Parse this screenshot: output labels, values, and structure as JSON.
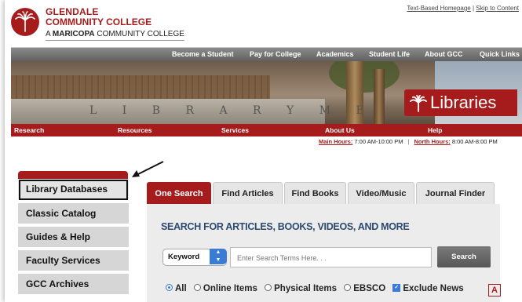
{
  "header": {
    "college_line1": "GLENDALE",
    "college_line2": "COMMUNITY COLLEGE",
    "maricopa_prefix": "A ",
    "maricopa_bold": "MARICOPA",
    "maricopa_suffix": " COMMUNITY COLLEGE",
    "link_text_based": "Text-Based Homepage",
    "link_sep": " | ",
    "link_skip": "Skip to Content"
  },
  "topnav": [
    "Become a Student",
    "Pay for College",
    "Academics",
    "Student Life",
    "About GCC",
    "Quick Links"
  ],
  "banner": {
    "wall_text": "L I B R A R Y   M E",
    "libraries_label": "Libraries"
  },
  "rednav": [
    "Research",
    "Resources",
    "Services",
    "About Us",
    "Help"
  ],
  "hours": {
    "main_label": "Main Hours:",
    "main_value": " 7:00 AM-10:00 PM",
    "sep": "|",
    "north_label": "North Hours:",
    "north_value": " 8:00 AM-8:00 PM"
  },
  "sidebar": {
    "items": [
      "Library Databases",
      "Classic Catalog",
      "Guides & Help",
      "Faculty Services",
      "GCC Archives"
    ]
  },
  "tabs": [
    "One Search",
    "Find Articles",
    "Find Books",
    "Video/Music",
    "Journal Finder"
  ],
  "search": {
    "heading": "SEARCH FOR ARTICLES, BOOKS, VIDEOS, AND MORE",
    "type_select": "Keyword",
    "placeholder": "Enter Search Terms Here. . .",
    "button": "Search",
    "options": [
      "All",
      "Online Items",
      "Physical Items",
      "EBSCO"
    ],
    "exclude_label": "Exclude News",
    "badge": "A"
  },
  "colors": {
    "brand_red": "#a61c1c",
    "heading_blue": "#2b4a6e",
    "accent_blue": "#3a7bd5"
  }
}
